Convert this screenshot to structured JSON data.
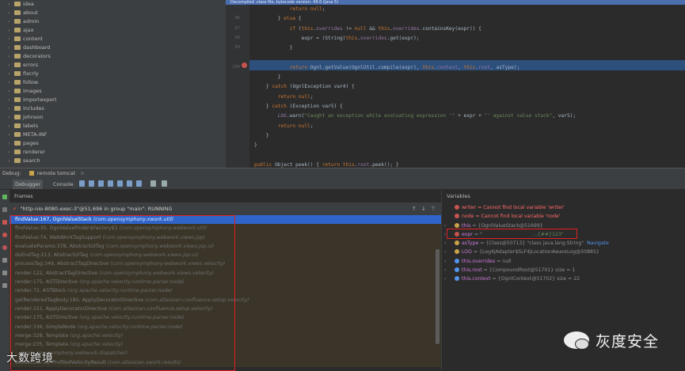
{
  "project_tree": {
    "items": [
      "idea",
      "about",
      "admin",
      "ajax",
      "content",
      "dashboard",
      "decorators",
      "errors",
      "fixcrly",
      "follow",
      "images",
      "importexport",
      "includes",
      "johnson",
      "labels",
      "META-INF",
      "pages",
      "renderer",
      "search"
    ]
  },
  "editor": {
    "banner": "Decompiled .class file, bytecode version: 49.0 (Java 5)",
    "lines": [
      {
        "n": "",
        "t": "            return null;"
      },
      {
        "n": "96",
        "t": "        } else {"
      },
      {
        "n": "97",
        "t": "            if (this.overrides != null && this.overrides.containsKey(expr)) {"
      },
      {
        "n": "98",
        "t": "                expr = (String)this.overrides.get(expr);"
      },
      {
        "n": "99",
        "t": "            }"
      },
      {
        "n": "",
        "t": ""
      },
      {
        "n": "100",
        "t": "            return Ognl.getValue(OgnlUtil.compile(expr), this.context, this.root, asType);"
      },
      {
        "n": "",
        "t": "        }"
      },
      {
        "n": "",
        "t": "    } catch (OgnlException var4) {"
      },
      {
        "n": "",
        "t": "        return null;"
      },
      {
        "n": "",
        "t": "    } catch (Exception var5) {"
      },
      {
        "n": "",
        "t": "        LOG.warn(\"Caught an exception while evaluating expression '\" + expr + \"' against value stack\", var5);"
      },
      {
        "n": "",
        "t": "        return null;"
      },
      {
        "n": "",
        "t": "    }"
      },
      {
        "n": "",
        "t": "}"
      },
      {
        "n": "",
        "t": ""
      },
      {
        "n": "",
        "t": "public Object peek() { return this.root.peek(); }"
      }
    ]
  },
  "debug": {
    "label": "Debug:",
    "config": "remote tomcat",
    "tabs": [
      "Debugger",
      "Console"
    ],
    "frames_label": "Frames",
    "variables_label": "Variables",
    "thread": "\"http-nio-8080-exec-3\"@51,696 in group \"main\": RUNNING",
    "frames": [
      {
        "m": "findValue:167, OgnlValueStack",
        "c": "(com.opensymphony.xwork.util)"
      },
      {
        "m": "findValue:30, OgnlValueFinder$Factory$1",
        "c": "(com.opensymphony.webwork.util)"
      },
      {
        "m": "findValue:74, WebWorkTagSupport",
        "c": "(com.opensymphony.webwork.views.jsp)"
      },
      {
        "m": "evaluateParams:378, AbstractUITag",
        "c": "(com.opensymphony.webwork.views.jsp.ui)"
      },
      {
        "m": "doEndTag:213, AbstractUITag",
        "c": "(com.opensymphony.webwork.views.jsp.ui)"
      },
      {
        "m": "processTag:349, AbstractTagDirective",
        "c": "(com.opensymphony.webwork.views.velocity)"
      },
      {
        "m": "render:122, AbstractTagDirective",
        "c": "(com.opensymphony.webwork.views.velocity)"
      },
      {
        "m": "render:175, ASTDirective",
        "c": "(org.apache.velocity.runtime.parser.node)"
      },
      {
        "m": "render:72, ASTBlock",
        "c": "(org.apache.velocity.runtime.parser.node)"
      },
      {
        "m": "getRenderedTagBody:180, ApplyDecoratorDirective",
        "c": "(com.atlassian.confluence.setup.velocity)"
      },
      {
        "m": "render:151, ApplyDecoratorDirective",
        "c": "(com.atlassian.confluence.setup.velocity)"
      },
      {
        "m": "render:175, ASTDirective",
        "c": "(org.apache.velocity.runtime.parser.node)"
      },
      {
        "m": "render:336, SimpleNode",
        "c": "(org.apache.velocity.runtime.parser.node)"
      },
      {
        "m": "merge:328, Template",
        "c": "(org.apache.velocity)"
      },
      {
        "m": "merge:235, Template",
        "c": "(org.apache.velocity)"
      },
      {
        "m": "...",
        "c": "(com.opensymphony.webwork.dispatcher)"
      },
      {
        "m": "doExecute:18, ProfiledVelocityResult",
        "c": "(com.atlassian.xwork.results)"
      }
    ],
    "variables": [
      {
        "kind": "err",
        "text": "writer = Cannot find local variable 'writer'"
      },
      {
        "kind": "err",
        "text": "node = Cannot find local variable 'node'"
      },
      {
        "kind": "obj",
        "name": "this",
        "val": "= {OgnlValueStack@51699}"
      },
      {
        "kind": "expr",
        "name": "expr",
        "val": "= \"",
        "tail": "...{##}123\""
      },
      {
        "kind": "obj",
        "name": "asType",
        "val": "= {Class@50713} \"class java.lang.String\"",
        "nav": "Navigate"
      },
      {
        "kind": "obj",
        "name": "LOG",
        "val": "= {Log4jAdapter$SLF4jLocationAwareLog@50885}"
      },
      {
        "kind": "field",
        "name": "this.overrides",
        "val": "= null"
      },
      {
        "kind": "field",
        "name": "this.root",
        "val": "= {CompoundRoot@51701}  size = 1"
      },
      {
        "kind": "field",
        "name": "this.context",
        "val": "= {OgnlContext@51702}  size = 22"
      }
    ]
  },
  "watermark": {
    "left": "大数跨境",
    "right": "灰度安全"
  }
}
